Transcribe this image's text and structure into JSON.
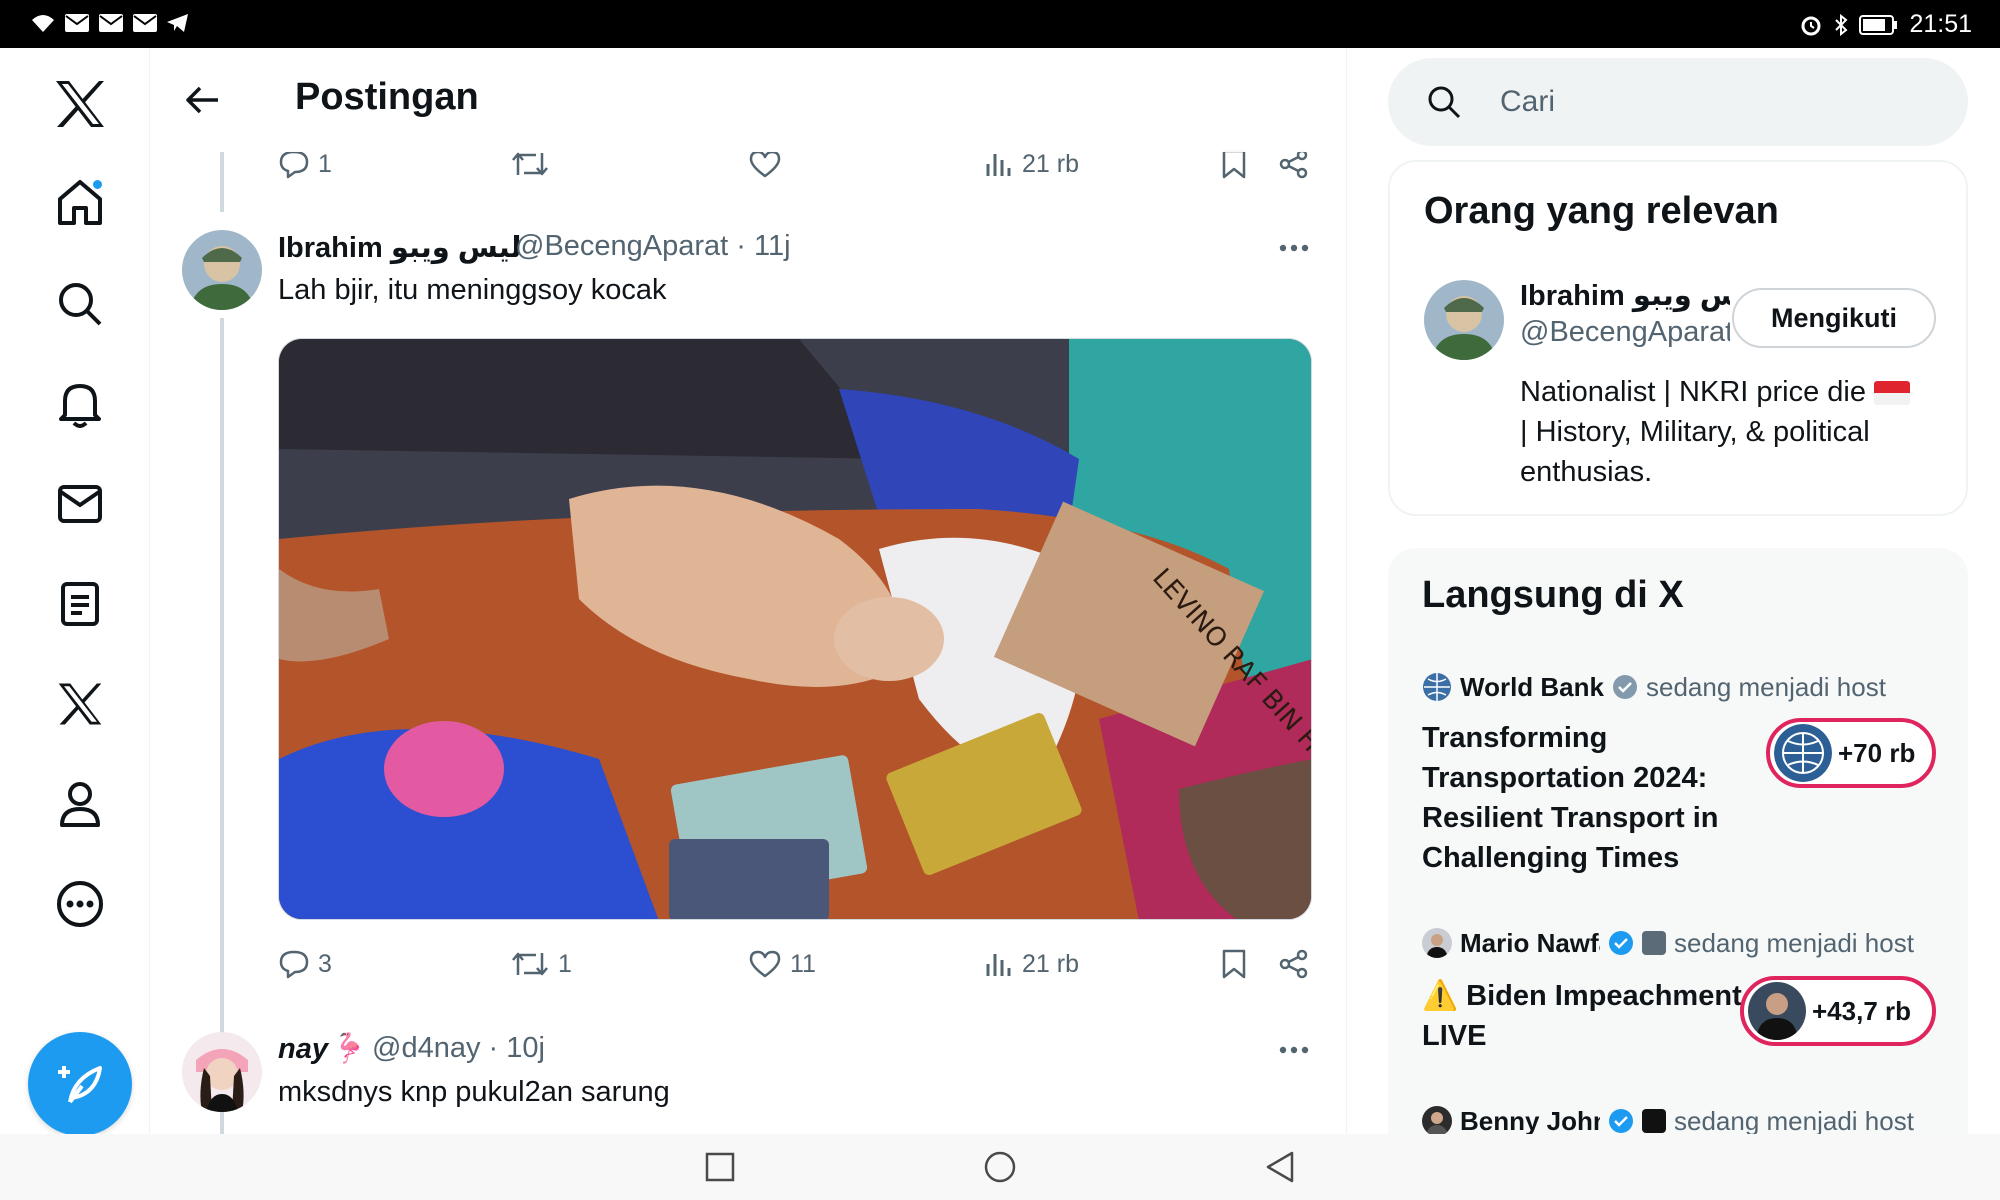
{
  "status_bar": {
    "time": "21:51"
  },
  "header": {
    "title": "Postingan"
  },
  "prev_tweet_actions": {
    "replies": "1",
    "retweets": "",
    "likes": "",
    "views": "21 rb"
  },
  "tweet": {
    "name": "Ibrahim ليس ويبو",
    "handle": "@BecengAparat · 11j",
    "text": "Lah bjir, itu meninggsoy kocak",
    "image_text": "LEVINO RAF BIN HENDRI AD",
    "actions": {
      "replies": "3",
      "retweets": "1",
      "likes": "11",
      "views": "21 rb"
    }
  },
  "reply": {
    "name": "nay🦩",
    "handle": "@d4nay · 10j",
    "text": "mksdnys knp pukul2an sarung"
  },
  "search": {
    "placeholder": "Cari"
  },
  "relevant": {
    "title": "Orang yang relevan",
    "person": {
      "name": "Ibrahim ليس ويبو",
      "handle": "@BecengAparat",
      "follow_label": "Mengikuti",
      "bio": "Nationalist | NKRI price die",
      "bio_cont": "| History, Military, & political enthusias."
    }
  },
  "live": {
    "title": "Langsung di X",
    "spaces": [
      {
        "host": "World Bank",
        "status": "sedang menjadi host",
        "title": "Transforming Transportation 2024: Resilient Transport in Challenging Times",
        "listeners": "+70 rb"
      },
      {
        "host": "Mario Nawfal",
        "status": "sedang menjadi host",
        "title": "⚠️ Biden Impeachment LIVE",
        "listeners": "+43,7 rb"
      },
      {
        "host": "Benny Johnson",
        "status": "sedang menjadi host"
      }
    ]
  },
  "colors": {
    "accent": "#1d9bf0",
    "live_ring": "#e0245e",
    "text_secondary": "#536471"
  },
  "icons": [
    "x-logo-icon",
    "home-icon",
    "search-icon",
    "bell-icon",
    "mail-icon",
    "list-icon",
    "x-premium-icon",
    "profile-icon",
    "more-icon",
    "compose-icon"
  ]
}
